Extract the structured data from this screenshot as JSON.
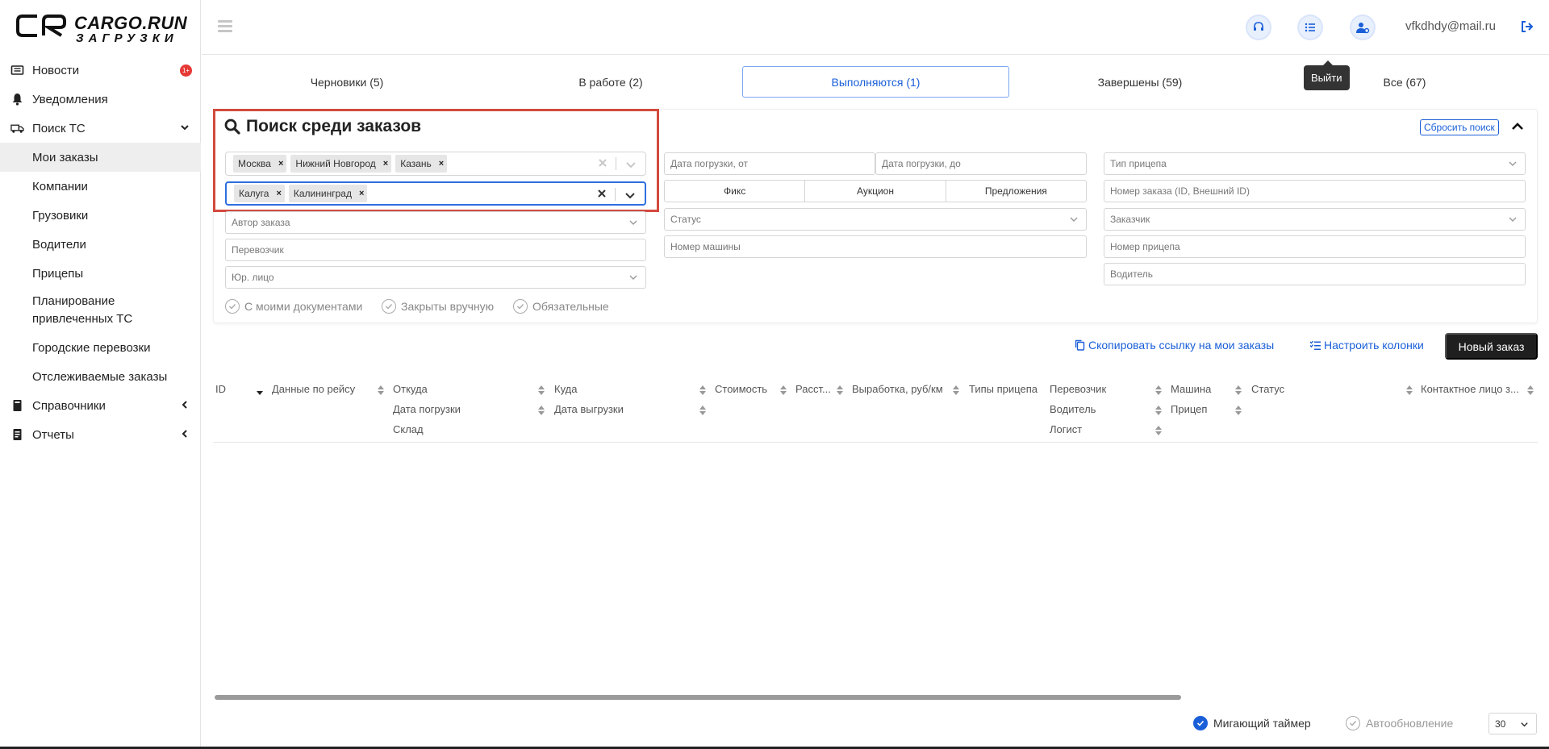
{
  "brand": {
    "name": "CARGO.RUN",
    "subtitle": "ЗАГРУЗКИ"
  },
  "sidebar": {
    "items": [
      {
        "label": "Новости",
        "icon": "newspaper-icon",
        "badge": "1+"
      },
      {
        "label": "Уведомления",
        "icon": "bell-icon"
      },
      {
        "label": "Поиск ТС",
        "icon": "truck-icon"
      },
      {
        "label": "Мои заказы"
      },
      {
        "label": "Компании"
      },
      {
        "label": "Грузовики"
      },
      {
        "label": "Водители"
      },
      {
        "label": "Прицепы"
      },
      {
        "label": "Планирование привлеченных ТС"
      },
      {
        "label": "Городские перевозки"
      },
      {
        "label": "Отслеживаемые заказы"
      },
      {
        "label": "Справочники",
        "icon": "book-icon"
      },
      {
        "label": "Отчеты",
        "icon": "report-icon"
      }
    ]
  },
  "header": {
    "user_email": "vfkdhdy@mail.ru",
    "logout_tooltip": "Выйти"
  },
  "tabs": [
    {
      "label": "Черновики (5)"
    },
    {
      "label": "В работе (2)"
    },
    {
      "label": "Выполняются (1)",
      "active": true
    },
    {
      "label": "Завершены (59)"
    },
    {
      "label": "Все (67)"
    }
  ],
  "search": {
    "title": "Поиск среди заказов",
    "reset_label": "Сбросить поиск",
    "from_chips": [
      "Москва",
      "Нижний Новгород",
      "Казань"
    ],
    "to_chips": [
      "Калуга",
      "Калининград"
    ],
    "chip_remove": "×",
    "placeholders": {
      "author": "Автор заказа",
      "carrier": "Перевозчик",
      "legal": "Юр. лицо",
      "load_from": "Дата погрузки, от",
      "load_to": "Дата погрузки, до",
      "status": "Статус",
      "car_number": "Номер машины",
      "trailer_type": "Тип прицепа",
      "order_number": "Номер заказа (ID, Внешний ID)",
      "customer": "Заказчик",
      "trailer_number": "Номер прицепа",
      "driver": "Водитель"
    },
    "segments": [
      "Фикс",
      "Аукцион",
      "Предложения"
    ],
    "checks": [
      "С моими документами",
      "Закрыты вручную",
      "Обязательные"
    ]
  },
  "actions": {
    "copy_link": "Скопировать ссылку на мои заказы",
    "columns": "Настроить колонки",
    "new_order": "Новый заказ"
  },
  "table": {
    "headers": {
      "id": "ID",
      "trip": "Данные по рейсу",
      "from": "Откуда",
      "load_date": "Дата погрузки",
      "warehouse": "Склад",
      "to": "Куда",
      "unload_date": "Дата выгрузки",
      "cost": "Стоимость",
      "distance": "Расст...",
      "output": "Выработка, руб/км",
      "trailer_types": "Типы прицепа",
      "carrier": "Перевозчик",
      "driver": "Водитель",
      "logist": "Логист",
      "car": "Машина",
      "trailer": "Прицеп",
      "status": "Статус",
      "contact": "Контактное лицо з..."
    }
  },
  "footer": {
    "blinking_timer": "Мигающий таймер",
    "auto_update": "Автообновление",
    "page_size": "30"
  },
  "colors": {
    "accent": "#1a5fd8",
    "highlight": "#d24a3e",
    "badge": "#e53935"
  }
}
